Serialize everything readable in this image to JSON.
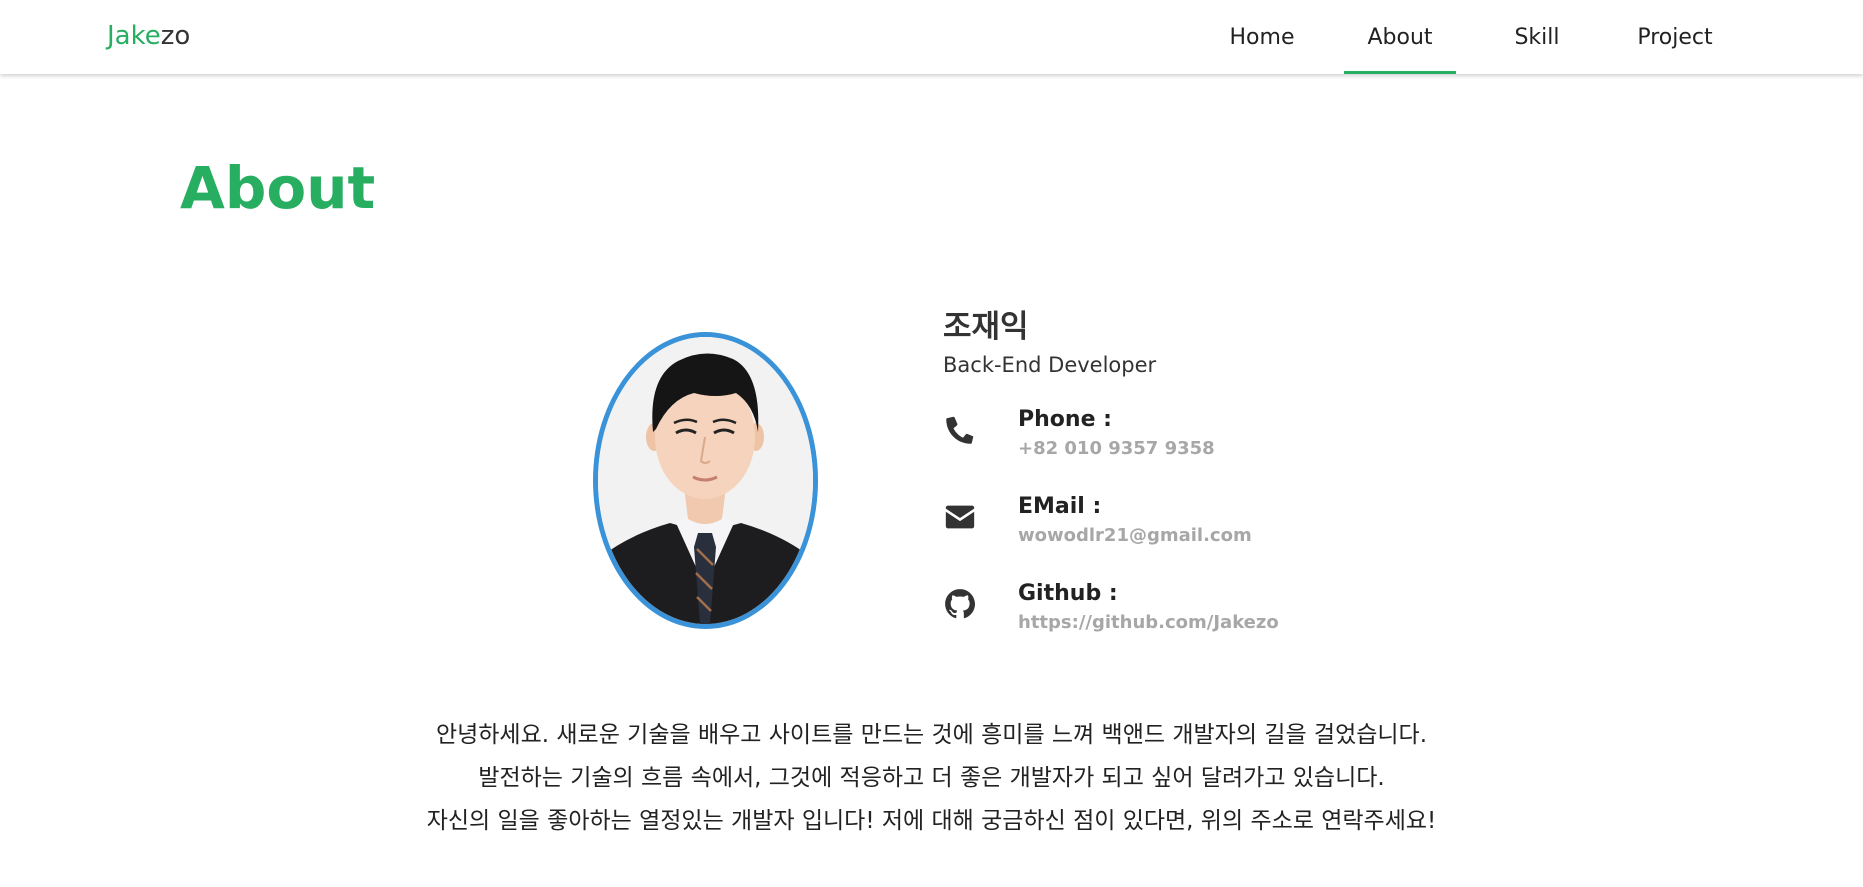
{
  "brand": {
    "part1": "Jake",
    "part2": "zo"
  },
  "nav": {
    "items": [
      {
        "label": "Home",
        "active": false
      },
      {
        "label": "About",
        "active": true
      },
      {
        "label": "Skill",
        "active": false
      },
      {
        "label": "Project",
        "active": false
      }
    ]
  },
  "about": {
    "title": "About",
    "name": "조재익",
    "role": "Back-End Developer",
    "contacts": [
      {
        "icon": "phone-icon",
        "label": "Phone :",
        "value": "+82 010 9357 9358"
      },
      {
        "icon": "envelope-icon",
        "label": "EMail :",
        "value": "wowodlr21@gmail.com"
      },
      {
        "icon": "github-icon",
        "label": "Github :",
        "value": "https://github.com/Jakezo"
      }
    ],
    "intro": [
      "안녕하세요. 새로운 기술을 배우고 사이트를 만드는 것에 흥미를 느껴 백앤드 개발자의 길을 걸었습니다.",
      "발전하는 기술의 흐름 속에서, 그것에 적응하고 더 좋은 개발자가 되고 싶어 달려가고 있습니다.",
      "자신의 일을 좋아하는 열정있는 개발자 입니다! 저에 대해 궁금하신 점이 있다면, 위의 주소로 연락주세요!"
    ]
  },
  "colors": {
    "accent": "#27ae60",
    "photo_border": "#3a93d8",
    "muted_text": "#a7a7a7"
  }
}
